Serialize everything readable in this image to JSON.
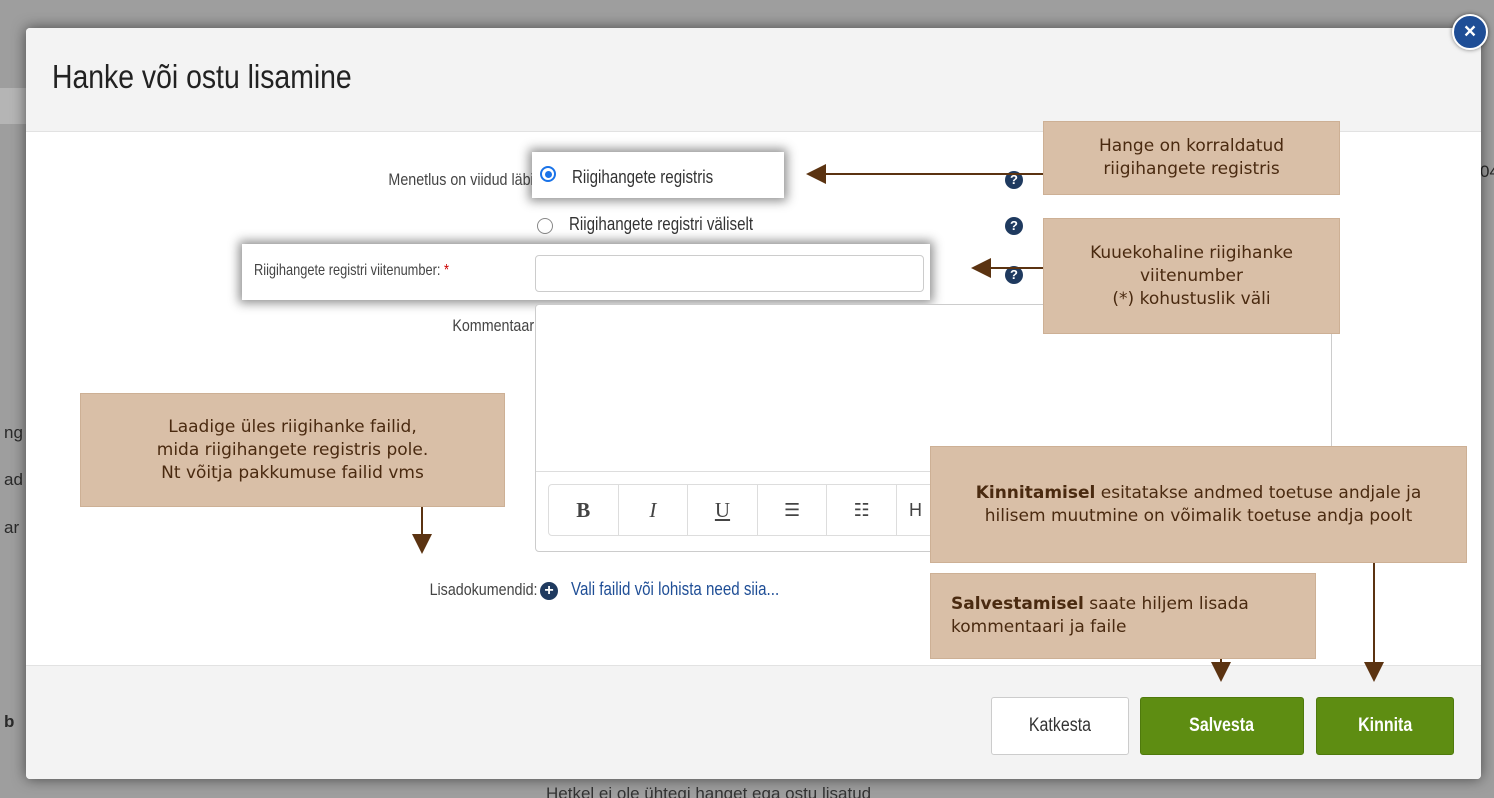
{
  "background": {
    "side_fragments": [
      "ng",
      "ad",
      "ar",
      "b"
    ],
    "right_fragment": "04",
    "bottom_text": "Hetkel ei ole ühtegi hanget ega ostu lisatud"
  },
  "dialog": {
    "title": "Hanke või ostu lisamine",
    "close_label": "×",
    "procedure": {
      "label": "Menetlus on viidud läbi:",
      "options": [
        {
          "label": "Riigihangete registris",
          "checked": true
        },
        {
          "label": "Riigihangete registri väliselt",
          "checked": false
        }
      ]
    },
    "reference": {
      "label": "Riigihangete registri viitenumber:",
      "required_mark": "*",
      "value": ""
    },
    "comment": {
      "label": "Kommentaar:",
      "value": "",
      "toolbar": [
        "B",
        "I",
        "U",
        "bullet-list-icon",
        "numbered-list-icon",
        "H"
      ]
    },
    "attachments": {
      "label": "Lisadokumendid:",
      "link": "Vali failid või lohista need siia..."
    },
    "buttons": {
      "cancel": "Katkesta",
      "save": "Salvesta",
      "confirm": "Kinnita"
    },
    "help_icon": "?",
    "add_icon": "+",
    "colors": {
      "primary": "#1f4e96",
      "green": "#5e8d12",
      "callout": "#d9bfa7",
      "arrow": "#5b3311"
    }
  },
  "callouts": {
    "registry": "Hange on korraldatud riigihangete registris",
    "reference": [
      "Kuuekohaline riigihanke",
      "viitenumber",
      "(*) kohustuslik väli"
    ],
    "upload": [
      "Laadige üles riigihanke failid,",
      "mida riigihangete registris pole.",
      "Nt võitja pakkumuse failid vms"
    ],
    "confirm_bold": "Kinnitamisel",
    "confirm_rest": "esitatakse andmed toetuse andjale ja hilisem muutmine on võimalik toetuse andja poolt",
    "save_bold": "Salvestamisel",
    "save_rest": "saate hiljem lisada kommentaari ja faile"
  }
}
